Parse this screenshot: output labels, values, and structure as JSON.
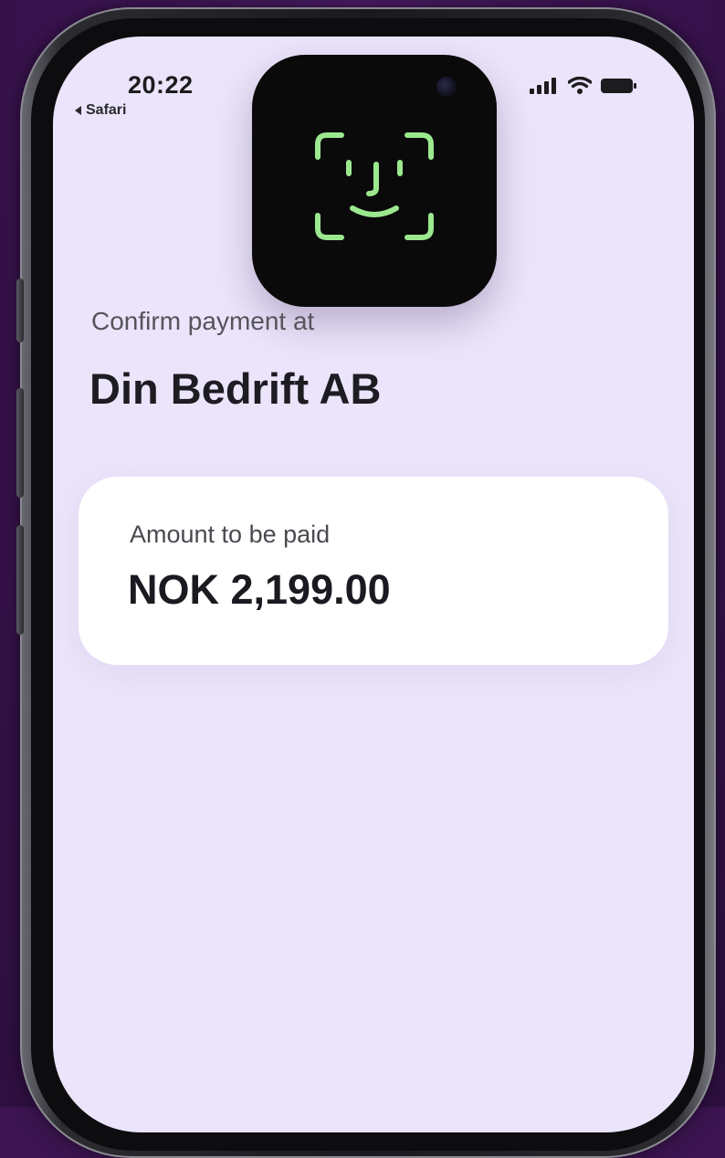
{
  "status_bar": {
    "time": "20:22",
    "back_app": "Safari",
    "icons": [
      "signal-bars-icon",
      "wifi-icon",
      "battery-icon"
    ]
  },
  "overlay": {
    "icon": "face-id-icon",
    "accent_color": "#9be88f"
  },
  "payment": {
    "confirm_label": "Confirm payment at",
    "merchant": "Din Bedrift AB",
    "amount_label": "Amount to be paid",
    "amount": "NOK 2,199.00"
  },
  "colors": {
    "background": "#3b1450",
    "screen": "#ebe4fa",
    "card": "#ffffff"
  }
}
